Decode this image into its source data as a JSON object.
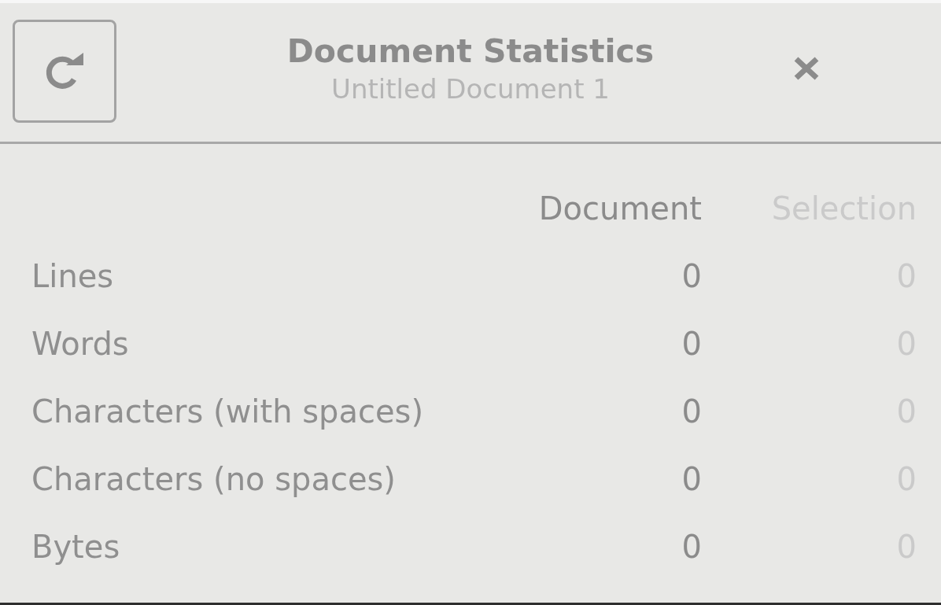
{
  "dialog": {
    "title": "Document Statistics",
    "subtitle": "Untitled Document 1"
  },
  "columns": [
    {
      "label": "Document",
      "disabled": false
    },
    {
      "label": "Selection",
      "disabled": true
    }
  ],
  "rows": [
    {
      "label": "Lines",
      "values": [
        "0",
        "0"
      ]
    },
    {
      "label": "Words",
      "values": [
        "0",
        "0"
      ]
    },
    {
      "label": "Characters (with spaces)",
      "values": [
        "0",
        "0"
      ]
    },
    {
      "label": "Characters (no spaces)",
      "values": [
        "0",
        "0"
      ]
    },
    {
      "label": "Bytes",
      "values": [
        "0",
        "0"
      ]
    }
  ]
}
